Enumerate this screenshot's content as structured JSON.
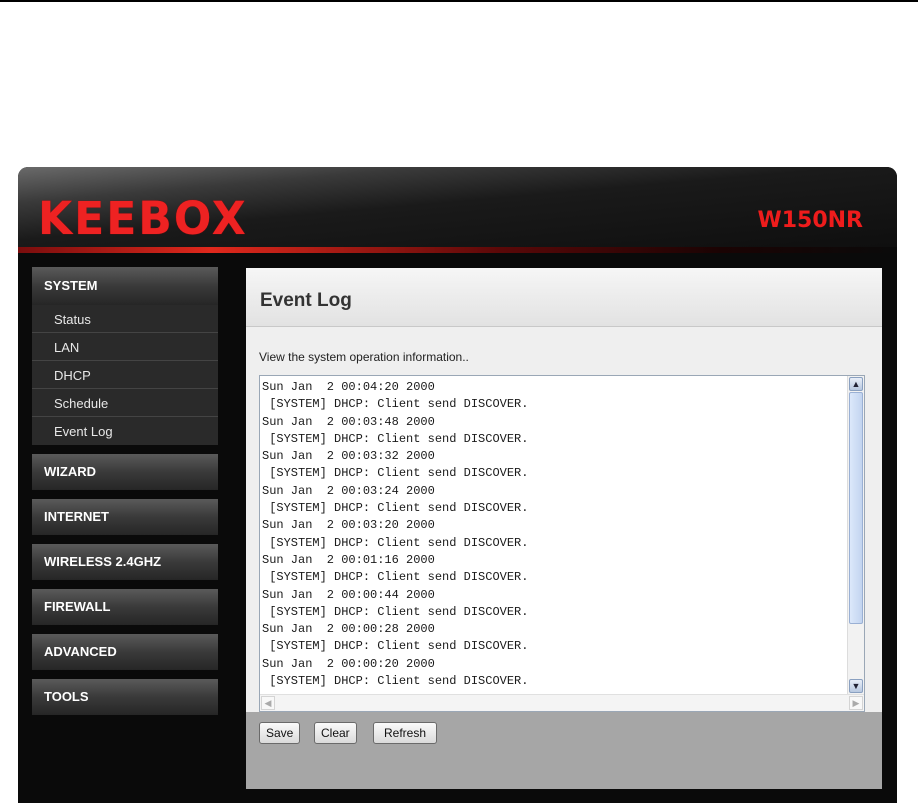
{
  "header": {
    "logo": "KEEBOX",
    "model": "W150NR"
  },
  "sidebar": {
    "system_label": "SYSTEM",
    "system_items": [
      "Status",
      "LAN",
      "DHCP",
      "Schedule",
      "Event Log"
    ],
    "groups": [
      "WIZARD",
      "INTERNET",
      "WIRELESS 2.4GHZ",
      "FIREWALL",
      "ADVANCED",
      "TOOLS"
    ]
  },
  "main": {
    "title": "Event Log",
    "description": "View the system operation information..",
    "log_lines": [
      "Sun Jan  2 00:04:20 2000",
      " [SYSTEM] DHCP: Client send DISCOVER.",
      "Sun Jan  2 00:03:48 2000",
      " [SYSTEM] DHCP: Client send DISCOVER.",
      "Sun Jan  2 00:03:32 2000",
      " [SYSTEM] DHCP: Client send DISCOVER.",
      "Sun Jan  2 00:03:24 2000",
      " [SYSTEM] DHCP: Client send DISCOVER.",
      "Sun Jan  2 00:03:20 2000",
      " [SYSTEM] DHCP: Client send DISCOVER.",
      "Sun Jan  2 00:01:16 2000",
      " [SYSTEM] DHCP: Client send DISCOVER.",
      "Sun Jan  2 00:00:44 2000",
      " [SYSTEM] DHCP: Client send DISCOVER.",
      "Sun Jan  2 00:00:28 2000",
      " [SYSTEM] DHCP: Client send DISCOVER.",
      "Sun Jan  2 00:00:20 2000",
      " [SYSTEM] DHCP: Client send DISCOVER."
    ],
    "buttons": {
      "save": "Save",
      "clear": "Clear",
      "refresh": "Refresh"
    }
  },
  "colors": {
    "brand_red": "#ee2222",
    "panel_gray": "#a6a6a6"
  }
}
